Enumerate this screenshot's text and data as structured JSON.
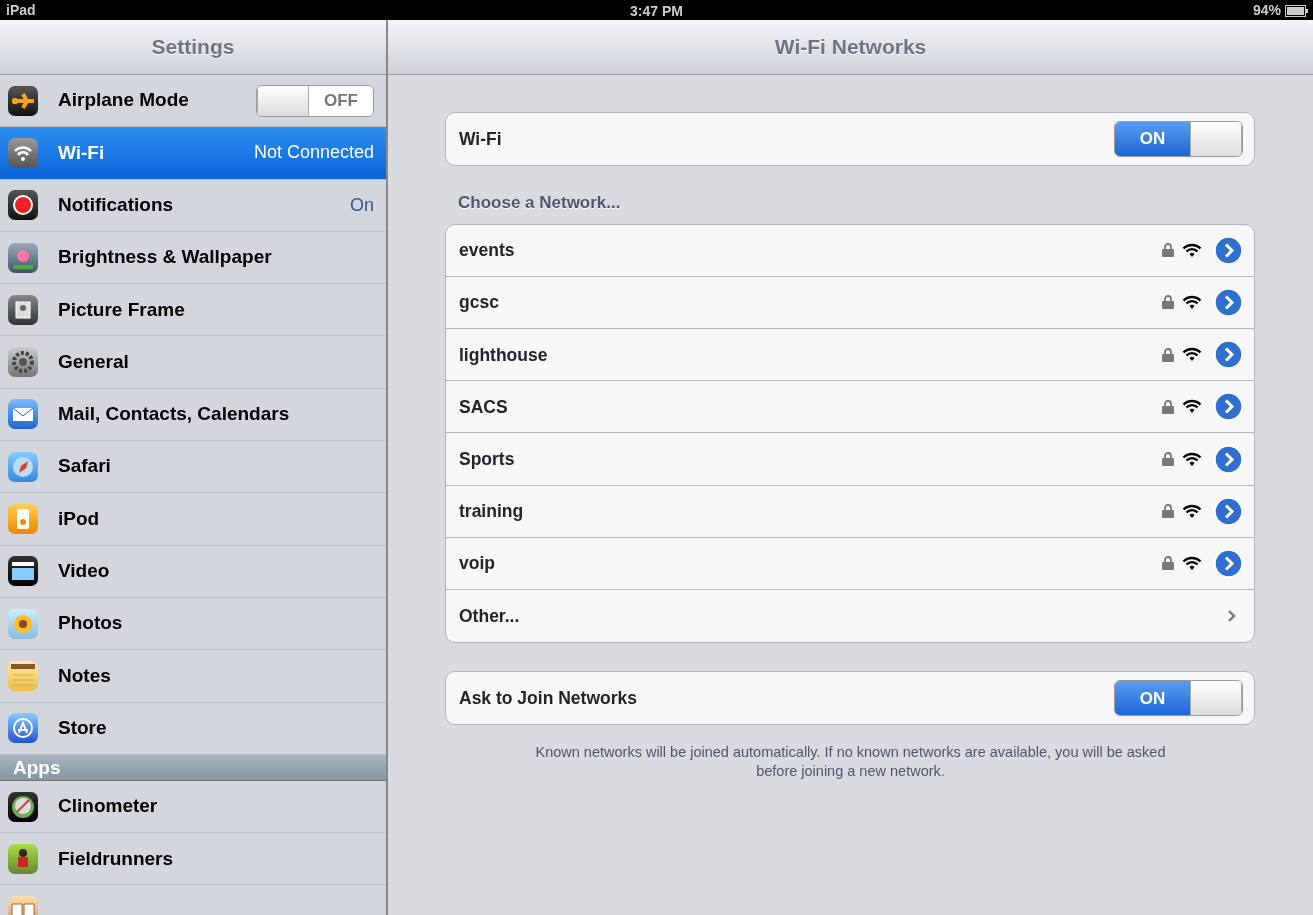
{
  "status_bar": {
    "device": "iPad",
    "time": "3:47 PM",
    "battery": "94%"
  },
  "sidebar": {
    "title": "Settings",
    "items": [
      {
        "label": "Airplane Mode",
        "kind": "toggle",
        "on": false,
        "toggle_text": "OFF",
        "selected": false
      },
      {
        "label": "Wi-Fi",
        "kind": "value",
        "value": "Not Connected",
        "selected": true
      },
      {
        "label": "Notifications",
        "kind": "value",
        "value": "On",
        "selected": false
      },
      {
        "label": "Brightness & Wallpaper",
        "kind": "plain",
        "selected": false
      },
      {
        "label": "Picture Frame",
        "kind": "plain",
        "selected": false
      },
      {
        "label": "General",
        "kind": "plain",
        "selected": false
      },
      {
        "label": "Mail, Contacts, Calendars",
        "kind": "plain",
        "selected": false
      },
      {
        "label": "Safari",
        "kind": "plain",
        "selected": false
      },
      {
        "label": "iPod",
        "kind": "plain",
        "selected": false
      },
      {
        "label": "Video",
        "kind": "plain",
        "selected": false
      },
      {
        "label": "Photos",
        "kind": "plain",
        "selected": false
      },
      {
        "label": "Notes",
        "kind": "plain",
        "selected": false
      },
      {
        "label": "Store",
        "kind": "plain",
        "selected": false
      },
      {
        "label": "Apps",
        "kind": "section"
      },
      {
        "label": "Clinometer",
        "kind": "plain",
        "selected": false
      },
      {
        "label": "Fieldrunners",
        "kind": "plain",
        "selected": false
      },
      {
        "kind": "plain",
        "selected": false
      }
    ]
  },
  "main": {
    "title": "Wi-Fi Networks",
    "wifi": {
      "label": "Wi-Fi",
      "on": true,
      "toggle_text": "ON"
    },
    "choose_label": "Choose a Network...",
    "networks": [
      {
        "name": "events",
        "kind": "network",
        "locked": true
      },
      {
        "name": "gcsc",
        "kind": "network",
        "locked": true
      },
      {
        "name": "lighthouse",
        "kind": "network",
        "locked": true
      },
      {
        "name": "SACS",
        "kind": "network",
        "locked": true
      },
      {
        "name": "Sports",
        "kind": "network",
        "locked": true
      },
      {
        "name": "training",
        "kind": "network",
        "locked": true
      },
      {
        "name": "voip",
        "kind": "network",
        "locked": true
      },
      {
        "name": "Other...",
        "kind": "other"
      }
    ],
    "ask_to_join": {
      "label": "Ask to Join Networks",
      "on": true,
      "toggle_text": "ON"
    },
    "footnote": "Known networks will be joined automatically.  If no known networks are available, you will be asked before joining a new network."
  }
}
